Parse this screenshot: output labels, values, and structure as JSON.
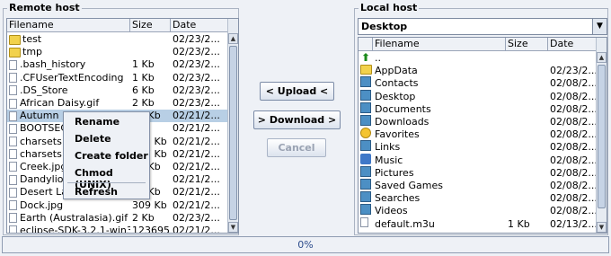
{
  "remote": {
    "title": "Remote host",
    "columns": [
      "Filename",
      "Size",
      "Date"
    ],
    "rows": [
      {
        "name": "test",
        "size": "",
        "date": "02/23/2...",
        "icon": "folder-icon"
      },
      {
        "name": "tmp",
        "size": "",
        "date": "02/23/2...",
        "icon": "folder-icon"
      },
      {
        "name": ".bash_history",
        "size": "1 Kb",
        "date": "02/23/2...",
        "icon": "file-icon"
      },
      {
        "name": ".CFUserTextEncoding",
        "size": "1 Kb",
        "date": "02/23/2...",
        "icon": "file-icon"
      },
      {
        "name": ".DS_Store",
        "size": "6 Kb",
        "date": "02/23/2...",
        "icon": "file-icon"
      },
      {
        "name": "African Daisy.gif",
        "size": "2 Kb",
        "date": "02/23/2...",
        "icon": "file-icon"
      },
      {
        "name": "Autumn Le...",
        "size": "59 Kb",
        "date": "02/21/2...",
        "icon": "file-icon",
        "selected": true
      },
      {
        "name": "BOOTSEC...",
        "size": "Kb",
        "date": "02/21/2...",
        "icon": "file-icon"
      },
      {
        "name": "charsets.ja...",
        "size": "401 Kb",
        "date": "02/21/2...",
        "icon": "file-icon"
      },
      {
        "name": "charsets.ja...",
        "size": "967 Kb",
        "date": "02/21/2...",
        "icon": "file-icon"
      },
      {
        "name": "Creek.jpg",
        "size": "58 Kb",
        "date": "02/21/2...",
        "icon": "file-icon"
      },
      {
        "name": "Dandylion...",
        "size": "Kb",
        "date": "02/21/2...",
        "icon": "file-icon"
      },
      {
        "name": "Desert Lan...",
        "size": "23 Kb",
        "date": "02/21/2...",
        "icon": "file-icon"
      },
      {
        "name": "Dock.jpg",
        "size": "309 Kb",
        "date": "02/21/2...",
        "icon": "file-icon"
      },
      {
        "name": "Earth (Australasia).gif",
        "size": "2 Kb",
        "date": "02/23/2...",
        "icon": "file-icon"
      },
      {
        "name": "eclipse-SDK-3.2.1-win32.zip",
        "size": "123695...",
        "date": "02/21/2...",
        "icon": "file-icon"
      }
    ]
  },
  "local": {
    "title": "Local host",
    "location": "Desktop",
    "columns": [
      "Filename",
      "Size",
      "Date"
    ],
    "rows": [
      {
        "name": "..",
        "size": "",
        "date": "",
        "icon": "up-arrow-icon"
      },
      {
        "name": "AppData",
        "size": "",
        "date": "02/23/2...",
        "icon": "folder-icon"
      },
      {
        "name": "Contacts",
        "size": "",
        "date": "02/08/2...",
        "icon": "contacts-icon"
      },
      {
        "name": "Desktop",
        "size": "",
        "date": "02/08/2...",
        "icon": "desktop-icon"
      },
      {
        "name": "Documents",
        "size": "",
        "date": "02/08/2...",
        "icon": "documents-icon"
      },
      {
        "name": "Downloads",
        "size": "",
        "date": "02/08/2...",
        "icon": "downloads-icon"
      },
      {
        "name": "Favorites",
        "size": "",
        "date": "02/08/2...",
        "icon": "favorites-icon"
      },
      {
        "name": "Links",
        "size": "",
        "date": "02/08/2...",
        "icon": "links-icon"
      },
      {
        "name": "Music",
        "size": "",
        "date": "02/08/2...",
        "icon": "music-icon"
      },
      {
        "name": "Pictures",
        "size": "",
        "date": "02/08/2...",
        "icon": "pictures-icon"
      },
      {
        "name": "Saved Games",
        "size": "",
        "date": "02/08/2...",
        "icon": "saved-games-icon"
      },
      {
        "name": "Searches",
        "size": "",
        "date": "02/08/2...",
        "icon": "searches-icon"
      },
      {
        "name": "Videos",
        "size": "",
        "date": "02/08/2...",
        "icon": "videos-icon"
      },
      {
        "name": "default.m3u",
        "size": "1 Kb",
        "date": "02/13/2...",
        "icon": "playlist-icon"
      }
    ]
  },
  "buttons": {
    "upload": "< Upload <",
    "download": "> Download >",
    "cancel": "Cancel"
  },
  "context_menu": {
    "items": [
      "Rename",
      "Delete",
      "Create folder",
      "Chmod (UNIX)",
      "Refresh"
    ]
  },
  "progress": {
    "label": "0%",
    "value": 0
  }
}
